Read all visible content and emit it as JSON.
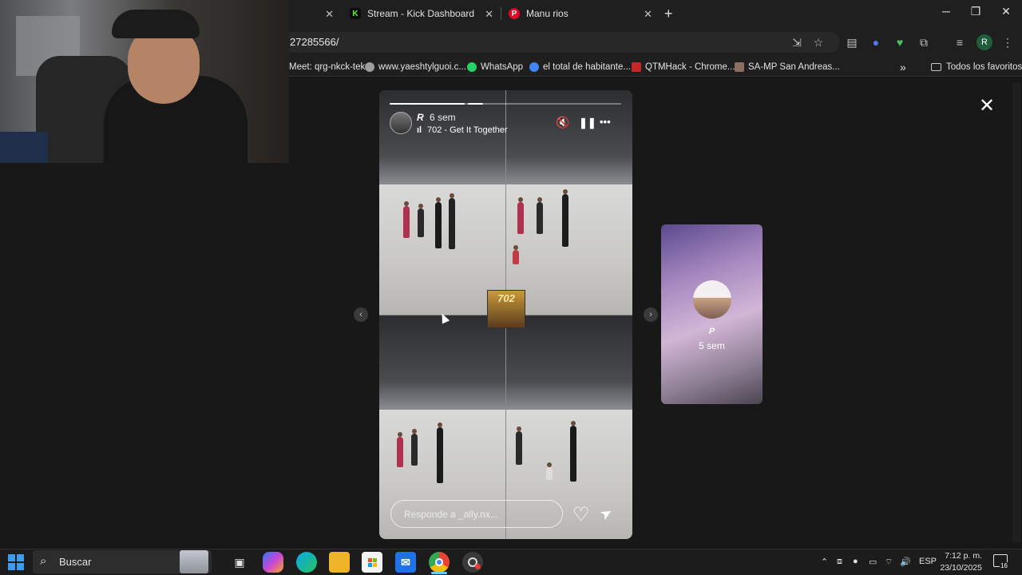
{
  "browser": {
    "tabs": [
      {
        "title": "",
        "active": true
      },
      {
        "title": "Stream - Kick Dashboard",
        "favicon": "K",
        "favicon_color": "#53fc18"
      },
      {
        "title": "Manu rios",
        "favicon": "P",
        "favicon_color": "#e60023"
      }
    ],
    "url": "27285566/",
    "bookmarks": [
      {
        "label": "Meet: qrg-nkck-tek",
        "icon_color": "#00897b"
      },
      {
        "label": "www.yaeshtylguoi.c...",
        "icon_color": "#9e9e9e"
      },
      {
        "label": "WhatsApp",
        "icon_color": "#25d366"
      },
      {
        "label": "el total de habitante...",
        "icon_color": "#4285f4"
      },
      {
        "label": "QTMHack - Chrome...",
        "icon_color": "#c62828"
      },
      {
        "label": "SA-MP San Andreas...",
        "icon_color": "#8d6e63"
      }
    ],
    "bookmarks_overflow": "»",
    "all_bookmarks": "Todos los favoritos",
    "profile_initial": "R"
  },
  "story": {
    "time_ago": "6 sem",
    "song": "702 - Get It Together",
    "reply_placeholder": "Responde a _ally.nx...",
    "sticker_text": "702",
    "progress": [
      1.0,
      0.2,
      0.0
    ]
  },
  "next_story": {
    "time_ago": "5 sem"
  },
  "taskbar": {
    "search_label": "Buscar",
    "language": "ESP",
    "time": "7:12 p. m.",
    "date": "23/10/2025",
    "notifications": "16"
  },
  "icons": {
    "close": "✕",
    "mute": "🔇",
    "pause": "❚❚",
    "more": "•••",
    "heart": "♡",
    "send": "➤",
    "prev": "‹",
    "next": "›"
  }
}
